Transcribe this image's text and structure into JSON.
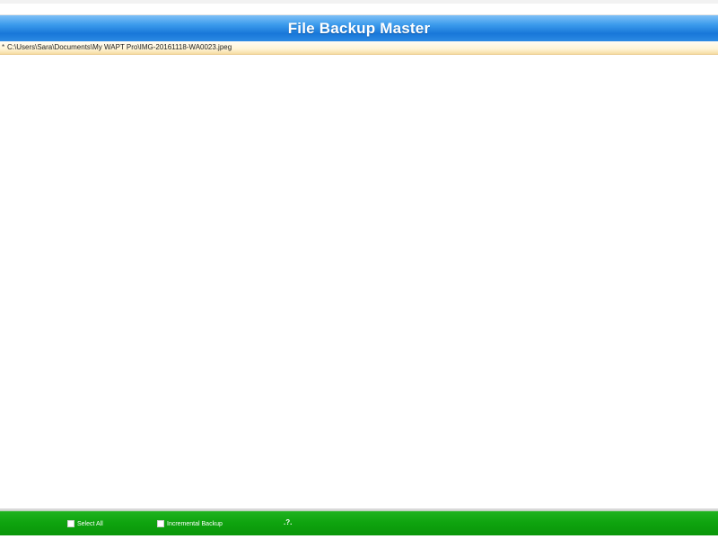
{
  "app": {
    "title": "File Backup Master"
  },
  "path_row": {
    "marker": "*",
    "path": "C:\\Users\\Sara\\Documents\\My WAPT Pro\\IMG-20161118-WA0023.jpeg"
  },
  "footer": {
    "select_all_label": "Select All",
    "incremental_backup_label": "Incremental Backup",
    "help_label": ".?."
  },
  "colors": {
    "title_bar": "#1f7fe0",
    "path_row": "#fff4d6",
    "footer_bar": "#0ea30e"
  },
  "icons": {
    "select_all_checkbox": "checkbox-unchecked",
    "incremental_backup_checkbox": "checkbox-unchecked"
  }
}
